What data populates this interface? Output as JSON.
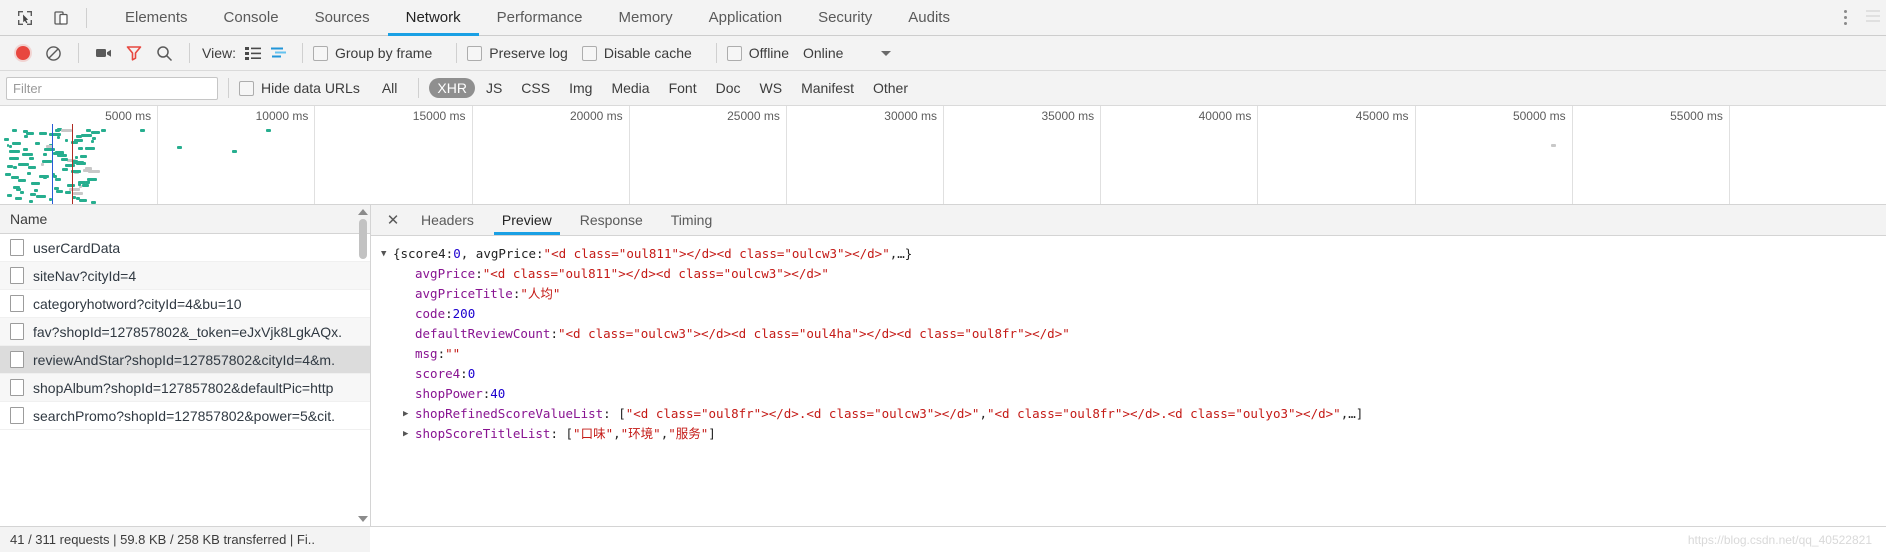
{
  "window": {
    "devtools_tabs": [
      {
        "label": "Elements",
        "active": false
      },
      {
        "label": "Console",
        "active": false
      },
      {
        "label": "Sources",
        "active": false
      },
      {
        "label": "Network",
        "active": true
      },
      {
        "label": "Performance",
        "active": false
      },
      {
        "label": "Memory",
        "active": false
      },
      {
        "label": "Application",
        "active": false
      },
      {
        "label": "Security",
        "active": false
      },
      {
        "label": "Audits",
        "active": false
      }
    ],
    "inspect_icon": "inspect-element-icon",
    "device_icon": "toggle-device-toolbar-icon",
    "more_icon": "vertical-dots-icon"
  },
  "network_toolbar": {
    "record_icon": "record-button-icon",
    "clear_icon": "clear-icon",
    "capture_screenshots_icon": "camera-icon",
    "filter_icon": "funnel-icon",
    "search_icon": "search-icon",
    "view_label": "View:",
    "view_list_icon": "list-view-icon",
    "view_waterfall_icon": "waterfall-view-icon",
    "group_by_frame": {
      "label": "Group by frame",
      "checked": false
    },
    "preserve_log": {
      "label": "Preserve log",
      "checked": false
    },
    "disable_cache": {
      "label": "Disable cache",
      "checked": false
    },
    "offline": {
      "label": "Offline",
      "checked": false
    },
    "throttling": {
      "value": "Online",
      "caret_icon": "chevron-down-icon"
    }
  },
  "filter_bar": {
    "filter_placeholder": "Filter",
    "filter_value": "",
    "hide_data_urls": {
      "label": "Hide data URLs",
      "checked": false
    },
    "types": [
      {
        "label": "All",
        "selected": false
      },
      {
        "label": "XHR",
        "selected": true
      },
      {
        "label": "JS",
        "selected": false
      },
      {
        "label": "CSS",
        "selected": false
      },
      {
        "label": "Img",
        "selected": false
      },
      {
        "label": "Media",
        "selected": false
      },
      {
        "label": "Font",
        "selected": false
      },
      {
        "label": "Doc",
        "selected": false
      },
      {
        "label": "WS",
        "selected": false
      },
      {
        "label": "Manifest",
        "selected": false
      },
      {
        "label": "Other",
        "selected": false
      }
    ]
  },
  "overview": {
    "ticks": [
      "5000 ms",
      "10000 ms",
      "15000 ms",
      "20000 ms",
      "25000 ms",
      "30000 ms",
      "35000 ms",
      "40000 ms",
      "45000 ms",
      "50000 ms",
      "55000 ms"
    ]
  },
  "request_list": {
    "column_header": "Name",
    "rows": [
      {
        "name": "userCardData",
        "selected": false
      },
      {
        "name": "siteNav?cityId=4",
        "selected": false
      },
      {
        "name": "categoryhotword?cityId=4&bu=10",
        "selected": false
      },
      {
        "name": "fav?shopId=127857802&_token=eJxVjk8LgkAQx.",
        "selected": false
      },
      {
        "name": "reviewAndStar?shopId=127857802&cityId=4&m.",
        "selected": true
      },
      {
        "name": "shopAlbum?shopId=127857802&defaultPic=http",
        "selected": false
      },
      {
        "name": "searchPromo?shopId=127857802&power=5&cit.",
        "selected": false
      }
    ]
  },
  "detail_tabs": {
    "close_icon": "close-icon",
    "tabs": [
      {
        "label": "Headers",
        "active": false
      },
      {
        "label": "Preview",
        "active": true
      },
      {
        "label": "Response",
        "active": false
      },
      {
        "label": "Timing",
        "active": false
      }
    ]
  },
  "preview": {
    "lines": [
      {
        "indent": 0,
        "arrow": "▼",
        "parts": [
          {
            "t": "plain",
            "v": "{score4: "
          },
          {
            "t": "num",
            "v": "0"
          },
          {
            "t": "plain",
            "v": ", avgPrice: "
          },
          {
            "t": "str",
            "v": "\"<d class=\"oul811\"></d><d class=\"oulcw3\"></d>\""
          },
          {
            "t": "plain",
            "v": ",…}"
          }
        ]
      },
      {
        "indent": 1,
        "arrow": "",
        "parts": [
          {
            "t": "key",
            "v": "avgPrice"
          },
          {
            "t": "plain",
            "v": ": "
          },
          {
            "t": "str",
            "v": "\"<d class=\"oul811\"></d><d class=\"oulcw3\"></d>\""
          }
        ]
      },
      {
        "indent": 1,
        "arrow": "",
        "parts": [
          {
            "t": "key",
            "v": "avgPriceTitle"
          },
          {
            "t": "plain",
            "v": ": "
          },
          {
            "t": "str",
            "v": "\"人均\""
          }
        ]
      },
      {
        "indent": 1,
        "arrow": "",
        "parts": [
          {
            "t": "key",
            "v": "code"
          },
          {
            "t": "plain",
            "v": ": "
          },
          {
            "t": "num",
            "v": "200"
          }
        ]
      },
      {
        "indent": 1,
        "arrow": "",
        "parts": [
          {
            "t": "key",
            "v": "defaultReviewCount"
          },
          {
            "t": "plain",
            "v": ": "
          },
          {
            "t": "str",
            "v": "\"<d class=\"oulcw3\"></d><d class=\"oul4ha\"></d><d class=\"oul8fr\"></d>\""
          }
        ]
      },
      {
        "indent": 1,
        "arrow": "",
        "parts": [
          {
            "t": "key",
            "v": "msg"
          },
          {
            "t": "plain",
            "v": ": "
          },
          {
            "t": "str",
            "v": "\"\""
          }
        ]
      },
      {
        "indent": 1,
        "arrow": "",
        "parts": [
          {
            "t": "key",
            "v": "score4"
          },
          {
            "t": "plain",
            "v": ": "
          },
          {
            "t": "num",
            "v": "0"
          }
        ]
      },
      {
        "indent": 1,
        "arrow": "",
        "parts": [
          {
            "t": "key",
            "v": "shopPower"
          },
          {
            "t": "plain",
            "v": ": "
          },
          {
            "t": "num",
            "v": "40"
          }
        ]
      },
      {
        "indent": 1,
        "arrow": "▶",
        "parts": [
          {
            "t": "key",
            "v": "shopRefinedScoreValueList"
          },
          {
            "t": "plain",
            "v": ": ["
          },
          {
            "t": "str",
            "v": "\"<d class=\"oul8fr\"></d>.<d class=\"oulcw3\"></d>\""
          },
          {
            "t": "plain",
            "v": ", "
          },
          {
            "t": "str",
            "v": "\"<d class=\"oul8fr\"></d>.<d class=\"oulyo3\"></d>\""
          },
          {
            "t": "plain",
            "v": ",…]"
          }
        ]
      },
      {
        "indent": 1,
        "arrow": "▶",
        "parts": [
          {
            "t": "key",
            "v": "shopScoreTitleList"
          },
          {
            "t": "plain",
            "v": ": ["
          },
          {
            "t": "str",
            "v": "\"口味\""
          },
          {
            "t": "plain",
            "v": ", "
          },
          {
            "t": "str",
            "v": "\"环境\""
          },
          {
            "t": "plain",
            "v": ", "
          },
          {
            "t": "str",
            "v": "\"服务\""
          },
          {
            "t": "plain",
            "v": "]"
          }
        ]
      }
    ]
  },
  "status_bar": {
    "text": "41 / 311 requests  |  59.8 KB / 258 KB transferred  |  Fi..",
    "watermark": "https://blog.csdn.net/qq_40522821"
  }
}
